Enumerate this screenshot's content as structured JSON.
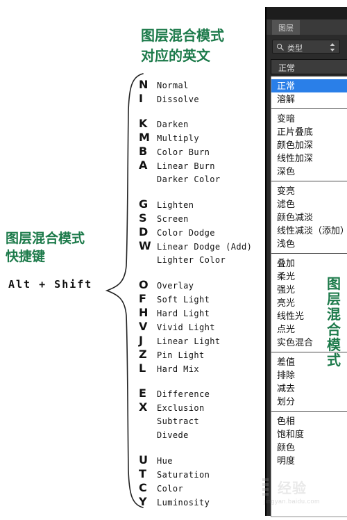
{
  "annotations": {
    "shortcut_title_line1": "图层混合模式",
    "shortcut_title_line2": "快捷键",
    "shortcut_keys": "Alt + Shift",
    "english_title_line1": "图层混合模式",
    "english_title_line2": "对应的英文",
    "vertical_label_chars": [
      "图",
      "层",
      "混",
      "合",
      "模",
      "式"
    ],
    "green_color": "#1c7a4a"
  },
  "english_list": {
    "groups": [
      {
        "rows": [
          {
            "key": "N",
            "name": "Normal"
          },
          {
            "key": "I",
            "name": "Dissolve"
          }
        ]
      },
      {
        "rows": [
          {
            "key": "K",
            "name": "Darken"
          },
          {
            "key": "M",
            "name": "Multiply"
          },
          {
            "key": "B",
            "name": "Color Burn"
          },
          {
            "key": "A",
            "name": "Linear Burn"
          },
          {
            "key": "",
            "name": "Darker Color"
          }
        ]
      },
      {
        "rows": [
          {
            "key": "G",
            "name": "Lighten"
          },
          {
            "key": "S",
            "name": "Screen"
          },
          {
            "key": "D",
            "name": "Color Dodge"
          },
          {
            "key": "W",
            "name": "Linear Dodge (Add)"
          },
          {
            "key": "",
            "name": "Lighter Color"
          }
        ]
      },
      {
        "rows": [
          {
            "key": "O",
            "name": "Overlay"
          },
          {
            "key": "F",
            "name": "Soft Light"
          },
          {
            "key": "H",
            "name": "Hard Light"
          },
          {
            "key": "V",
            "name": "Vivid Light"
          },
          {
            "key": "J",
            "name": "Linear Light"
          },
          {
            "key": "Z",
            "name": "Pin Light"
          },
          {
            "key": "L",
            "name": "Hard Mix"
          }
        ]
      },
      {
        "rows": [
          {
            "key": "E",
            "name": "Difference"
          },
          {
            "key": "X",
            "name": "Exclusion"
          },
          {
            "key": "",
            "name": "Subtract"
          },
          {
            "key": "",
            "name": "Divede"
          }
        ]
      },
      {
        "rows": [
          {
            "key": "U",
            "name": "Hue"
          },
          {
            "key": "T",
            "name": "Saturation"
          },
          {
            "key": "C",
            "name": "Color"
          },
          {
            "key": "Y",
            "name": "Luminosity"
          }
        ]
      }
    ]
  },
  "photoshop_panel": {
    "tab_label": "图层",
    "filter_value": "类型",
    "filter_icon": "search-icon",
    "stepper_icon": "up-down-arrows-icon",
    "blend_mode_value": "正常",
    "selected_color": "#2a7fe8",
    "dropdown_groups": [
      {
        "items": [
          {
            "label": "正常",
            "selected": true
          },
          {
            "label": "溶解",
            "selected": false
          }
        ]
      },
      {
        "items": [
          {
            "label": "变暗",
            "selected": false
          },
          {
            "label": "正片叠底",
            "selected": false
          },
          {
            "label": "颜色加深",
            "selected": false
          },
          {
            "label": "线性加深",
            "selected": false
          },
          {
            "label": "深色",
            "selected": false
          }
        ]
      },
      {
        "items": [
          {
            "label": "变亮",
            "selected": false
          },
          {
            "label": "滤色",
            "selected": false
          },
          {
            "label": "颜色减淡",
            "selected": false
          },
          {
            "label": "线性减淡（添加）",
            "selected": false
          },
          {
            "label": "浅色",
            "selected": false
          }
        ]
      },
      {
        "items": [
          {
            "label": "叠加",
            "selected": false
          },
          {
            "label": "柔光",
            "selected": false
          },
          {
            "label": "强光",
            "selected": false
          },
          {
            "label": "亮光",
            "selected": false
          },
          {
            "label": "线性光",
            "selected": false
          },
          {
            "label": "点光",
            "selected": false
          },
          {
            "label": "实色混合",
            "selected": false
          }
        ]
      },
      {
        "items": [
          {
            "label": "差值",
            "selected": false
          },
          {
            "label": "排除",
            "selected": false
          },
          {
            "label": "减去",
            "selected": false
          },
          {
            "label": "划分",
            "selected": false
          }
        ]
      },
      {
        "items": [
          {
            "label": "色相",
            "selected": false
          },
          {
            "label": "饱和度",
            "selected": false
          },
          {
            "label": "颜色",
            "selected": false
          },
          {
            "label": "明度",
            "selected": false
          }
        ]
      }
    ]
  },
  "watermark": {
    "text_cn": "经验",
    "url": "jingyan.baidu.com"
  }
}
